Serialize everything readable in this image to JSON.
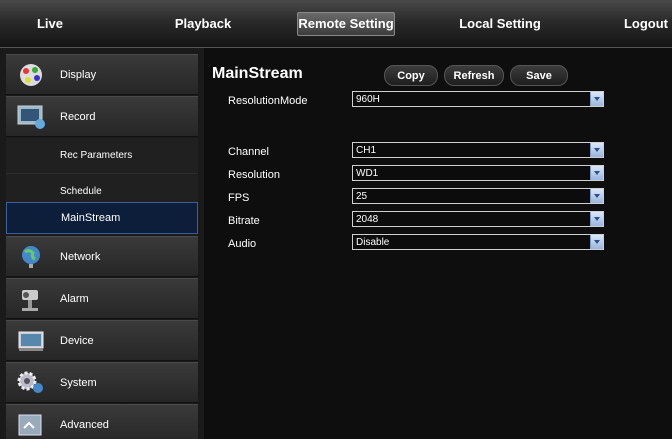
{
  "nav": {
    "tabs": [
      {
        "label": "Live"
      },
      {
        "label": "Playback"
      },
      {
        "label": "Remote Setting",
        "active": true
      },
      {
        "label": "Local Setting"
      },
      {
        "label": "Logout"
      }
    ]
  },
  "sidebar": {
    "items": [
      {
        "label": "Display",
        "icon": "display-icon"
      },
      {
        "label": "Record",
        "icon": "record-icon"
      },
      {
        "label": "Rec Parameters"
      },
      {
        "label": "Schedule"
      },
      {
        "label": "MainStream",
        "active": true
      },
      {
        "label": "Network",
        "icon": "network-icon"
      },
      {
        "label": "Alarm",
        "icon": "alarm-icon"
      },
      {
        "label": "Device",
        "icon": "device-icon"
      },
      {
        "label": "System",
        "icon": "system-icon"
      },
      {
        "label": "Advanced",
        "icon": "advanced-icon"
      }
    ]
  },
  "main": {
    "title": "MainStream",
    "buttons": {
      "copy": "Copy",
      "refresh": "Refresh",
      "save": "Save"
    },
    "resolution_mode": {
      "label": "ResolutionMode",
      "value": "960H"
    },
    "fields": [
      {
        "label": "Channel",
        "value": "CH1"
      },
      {
        "label": "Resolution",
        "value": "WD1"
      },
      {
        "label": "FPS",
        "value": "25"
      },
      {
        "label": "Bitrate",
        "value": "2048"
      },
      {
        "label": "Audio",
        "value": "Disable"
      }
    ]
  },
  "colors": {
    "accent": "#3b5f99",
    "active_bg": "#0c1e3a",
    "dropdown_arrow": "#9ab4dc"
  }
}
